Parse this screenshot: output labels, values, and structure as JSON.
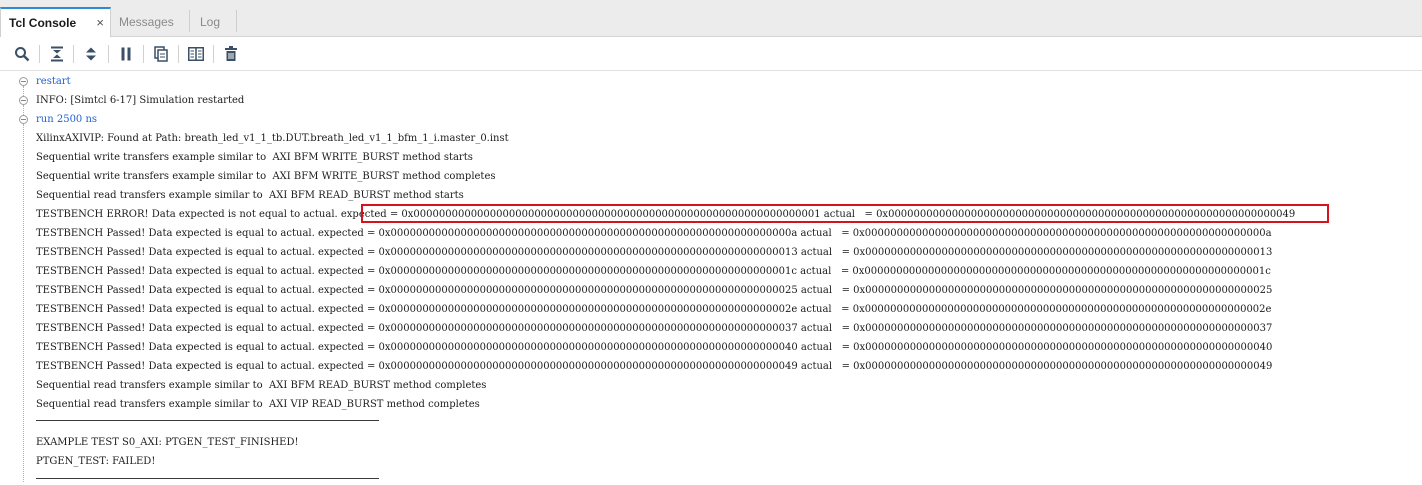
{
  "tabs": [
    {
      "label": "Tcl Console",
      "active": true,
      "close": "×"
    },
    {
      "label": "Messages",
      "active": false
    },
    {
      "label": "Log",
      "active": false
    }
  ],
  "toolbar": {
    "icons": [
      "search-icon",
      "collapse-all-icon",
      "expand-all-icon",
      "pause-icon",
      "copy-icon",
      "columns-icon",
      "delete-icon"
    ]
  },
  "colors": {
    "accent": "#2d8ad6",
    "command": "#1f5fcf",
    "highlight": "#d4141c"
  },
  "console": {
    "lines": [
      "restart",
      "INFO: [Simtcl 6-17] Simulation restarted",
      "run 2500 ns",
      "XilinxAXIVIP: Found at Path: breath_led_v1_1_tb.DUT.breath_led_v1_1_bfm_1_i.master_0.inst",
      "Sequential write transfers example similar to  AXI BFM WRITE_BURST method starts",
      "Sequential write transfers example similar to  AXI BFM WRITE_BURST method completes",
      "Sequential read transfers example similar to  AXI BFM READ_BURST method starts",
      "TESTBENCH ERROR! Data expected is not equal to actual. expected = 0x0000000000000000000000000000000000000000000000000000000000000001 actual   = 0x0000000000000000000000000000000000000000000000000000000000000049",
      "TESTBENCH Passed! Data expected is equal to actual. expected = 0x000000000000000000000000000000000000000000000000000000000000000a actual   = 0x000000000000000000000000000000000000000000000000000000000000000a",
      "TESTBENCH Passed! Data expected is equal to actual. expected = 0x0000000000000000000000000000000000000000000000000000000000000013 actual   = 0x0000000000000000000000000000000000000000000000000000000000000013",
      "TESTBENCH Passed! Data expected is equal to actual. expected = 0x000000000000000000000000000000000000000000000000000000000000001c actual   = 0x000000000000000000000000000000000000000000000000000000000000001c",
      "TESTBENCH Passed! Data expected is equal to actual. expected = 0x0000000000000000000000000000000000000000000000000000000000000025 actual   = 0x0000000000000000000000000000000000000000000000000000000000000025",
      "TESTBENCH Passed! Data expected is equal to actual. expected = 0x000000000000000000000000000000000000000000000000000000000000002e actual   = 0x000000000000000000000000000000000000000000000000000000000000002e",
      "TESTBENCH Passed! Data expected is equal to actual. expected = 0x0000000000000000000000000000000000000000000000000000000000000037 actual   = 0x0000000000000000000000000000000000000000000000000000000000000037",
      "TESTBENCH Passed! Data expected is equal to actual. expected = 0x0000000000000000000000000000000000000000000000000000000000000040 actual   = 0x0000000000000000000000000000000000000000000000000000000000000040",
      "TESTBENCH Passed! Data expected is equal to actual. expected = 0x0000000000000000000000000000000000000000000000000000000000000049 actual   = 0x0000000000000000000000000000000000000000000000000000000000000049",
      "Sequential read transfers example similar to  AXI BFM READ_BURST method completes",
      "Sequential read transfers example similar to  AXI VIP READ_BURST method completes",
      "EXAMPLE TEST S0_AXI: PTGEN_TEST_FINISHED!",
      "PTGEN_TEST: FAILED!"
    ]
  }
}
